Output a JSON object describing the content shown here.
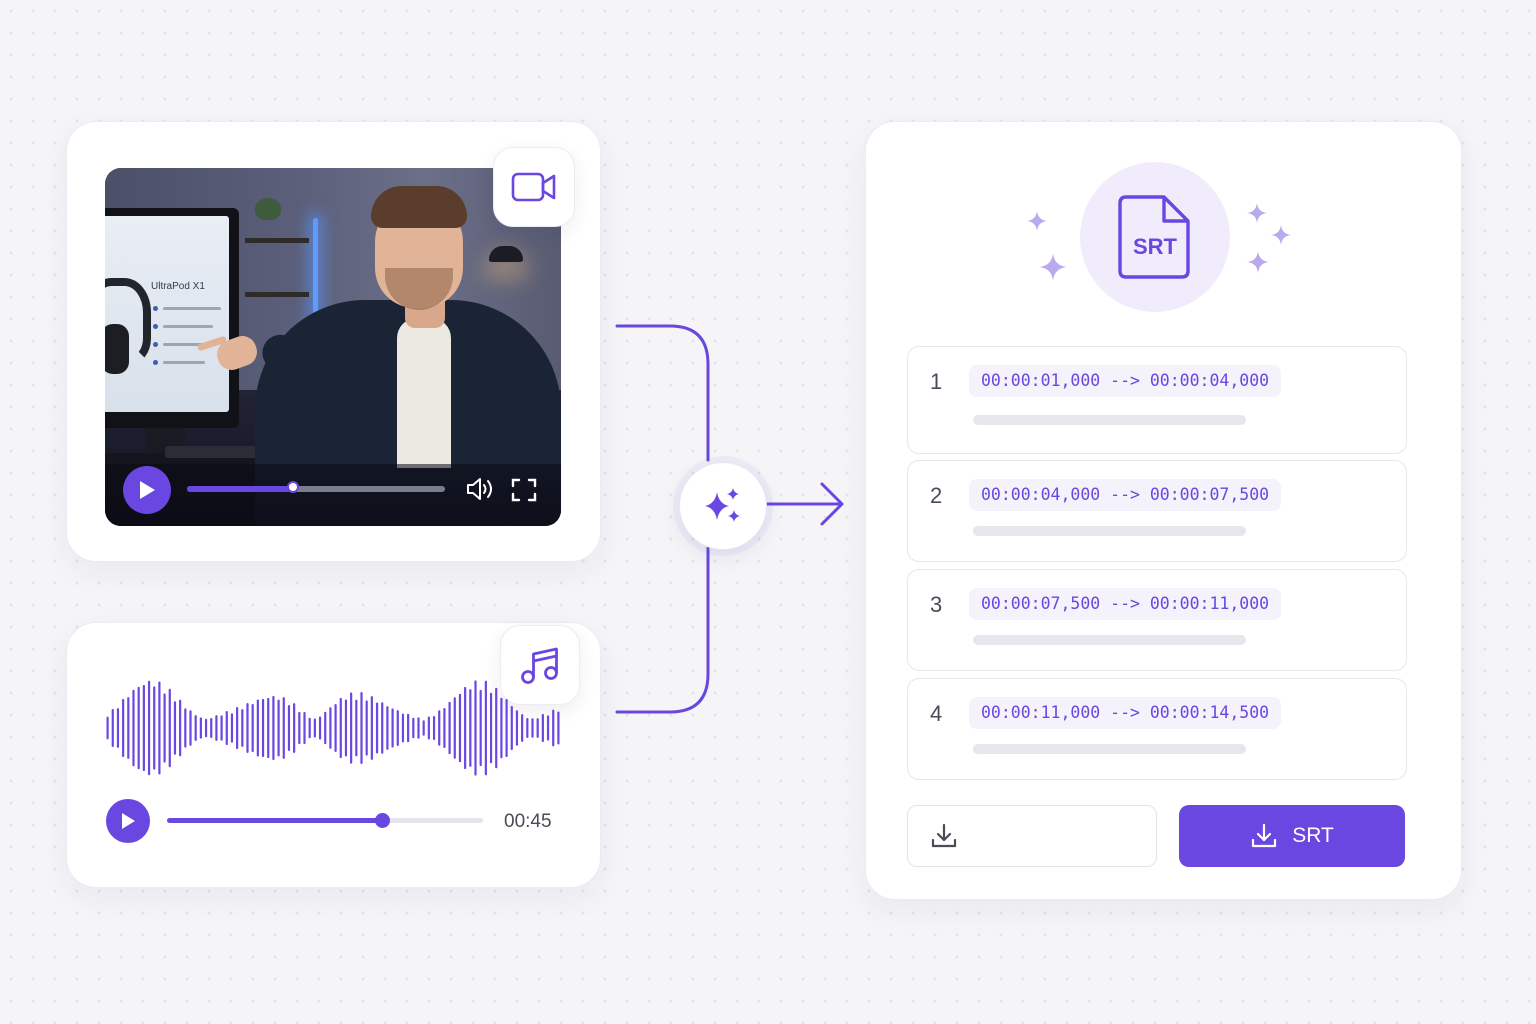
{
  "video": {
    "monitor_title": "UltraPod X1",
    "progress": 0.41
  },
  "audio": {
    "time": "00:45",
    "progress": 0.68
  },
  "srt": {
    "file_label": "SRT",
    "cues": [
      {
        "index": "1",
        "time": "00:00:01,000 --> 00:00:04,000"
      },
      {
        "index": "2",
        "time": "00:00:04,000 --> 00:00:07,500"
      },
      {
        "index": "3",
        "time": "00:00:07,500 --> 00:00:11,000"
      },
      {
        "index": "4",
        "time": "00:00:11,000 --> 00:00:14,500"
      }
    ],
    "download_label": "SRT"
  },
  "icons": {
    "video_badge": "video-camera-icon",
    "audio_badge": "music-note-icon",
    "ai": "sparkles-icon",
    "file": "srt-file-icon",
    "download": "download-icon",
    "play": "play-icon",
    "volume": "volume-icon",
    "fullscreen": "fullscreen-icon"
  },
  "colors": {
    "accent": "#6a47e0",
    "accent_light": "#f0ecfb",
    "background": "#f5f5f8"
  }
}
